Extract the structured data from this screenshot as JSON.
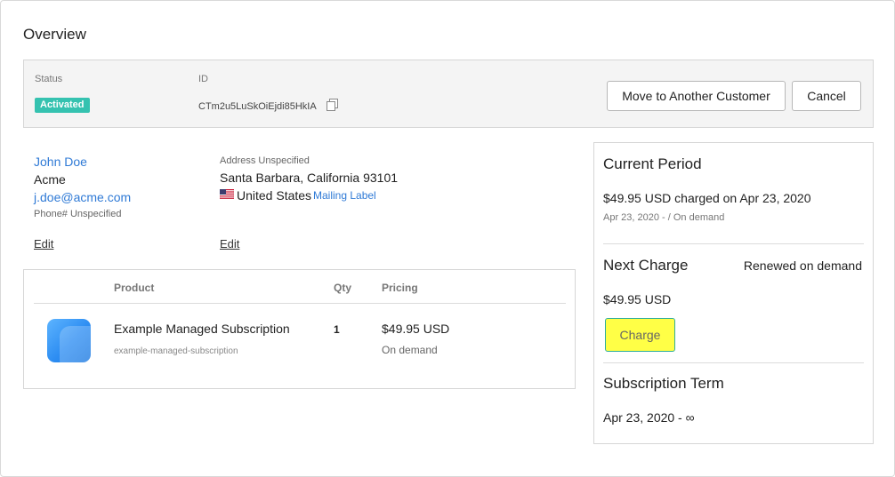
{
  "page": {
    "title": "Overview"
  },
  "status_bar": {
    "status_label": "Status",
    "status_value": "Activated",
    "id_label": "ID",
    "id_value": "CTm2u5LuSkOiEjdi85HkIA",
    "move_button": "Move to Another Customer",
    "cancel_button": "Cancel"
  },
  "customer": {
    "name": "John Doe",
    "company": "Acme",
    "email": "j.doe@acme.com",
    "phone": "Phone# Unspecified",
    "edit_label": "Edit"
  },
  "address": {
    "label": "Address Unspecified",
    "line": "Santa Barbara, California 93101",
    "country": "United States",
    "mailing_label": "Mailing Label",
    "edit_label": "Edit"
  },
  "product_table": {
    "headers": {
      "product": "Product",
      "qty": "Qty",
      "pricing": "Pricing"
    },
    "row": {
      "name": "Example Managed Subscription",
      "slug": "example-managed-subscription",
      "qty": "1",
      "price": "$49.95 USD",
      "price_sub": "On demand"
    }
  },
  "current_period": {
    "title": "Current Period",
    "text": "$49.95 USD charged on Apr 23, 2020",
    "sub": "Apr 23, 2020 - / On demand"
  },
  "next_charge": {
    "title": "Next Charge",
    "renewal": "Renewed on demand",
    "amount": "$49.95 USD",
    "charge_button": "Charge"
  },
  "subscription_term": {
    "title": "Subscription Term",
    "text": "Apr 23, 2020 - ∞"
  },
  "colors": {
    "badge": "#35c2b0",
    "link": "#2f7ad6",
    "charge_button_bg": "#ffff46",
    "charge_button_border": "#2fae9a"
  },
  "icons": {
    "copy": "copy-icon",
    "flag": "us-flag-icon",
    "product": "product-icon"
  }
}
